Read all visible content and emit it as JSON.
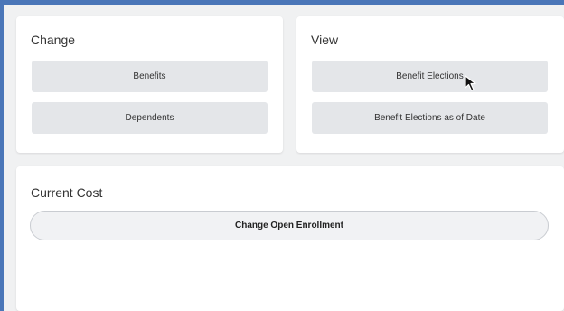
{
  "change_card": {
    "title": "Change",
    "buttons": [
      "Benefits",
      "Dependents"
    ]
  },
  "view_card": {
    "title": "View",
    "buttons": [
      "Benefit Elections",
      "Benefit Elections as of Date"
    ]
  },
  "cost_card": {
    "title": "Current Cost",
    "button": "Change Open Enrollment"
  },
  "cursor": {
    "icon": "mouse-pointer-icon"
  },
  "colors": {
    "frame_border": "#4a76b8",
    "background": "#f0f1f2",
    "button_bg": "#e4e6e9"
  }
}
